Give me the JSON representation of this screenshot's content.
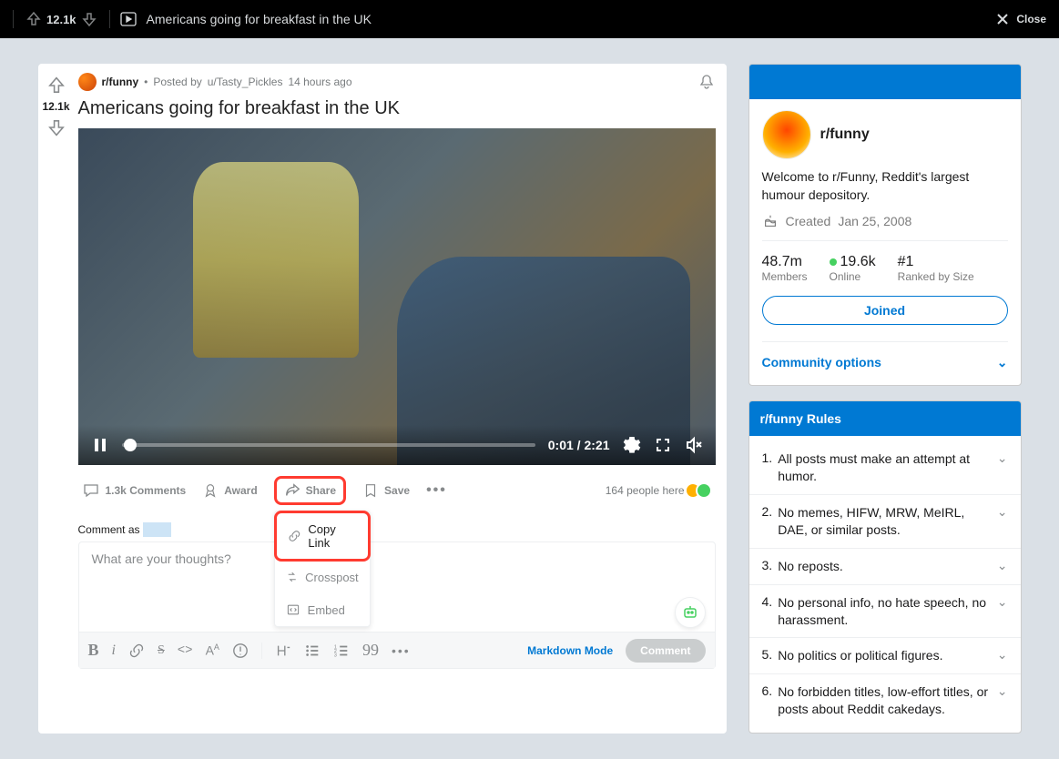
{
  "topbar": {
    "score": "12.1k",
    "title": "Americans going for breakfast in the UK",
    "close": "Close"
  },
  "post": {
    "score": "12.1k",
    "subreddit": "r/funny",
    "posted_by_prefix": "Posted by",
    "author": "u/Tasty_Pickles",
    "time": "14 hours ago",
    "title": "Americans going for breakfast in the UK"
  },
  "video": {
    "current": "0:01",
    "sep": " / ",
    "total": "2:21"
  },
  "actions": {
    "comments": "1.3k Comments",
    "award": "Award",
    "share": "Share",
    "save": "Save",
    "viewers": "164 people here"
  },
  "share_menu": {
    "copy": "Copy Link",
    "crosspost": "Crosspost",
    "embed": "Embed"
  },
  "comment": {
    "prefix": "Comment as",
    "placeholder": "What are your thoughts?",
    "markdown": "Markdown Mode",
    "submit": "Comment"
  },
  "sidebar": {
    "about_name": "r/funny",
    "about_desc": "Welcome to r/Funny, Reddit's largest humour depository.",
    "created_prefix": "Created",
    "created_date": "Jan 25, 2008",
    "members_val": "48.7m",
    "members_lab": "Members",
    "online_val": "19.6k",
    "online_lab": "Online",
    "rank_val": "#1",
    "rank_lab": "Ranked by Size",
    "join": "Joined",
    "community_opts": "Community options",
    "rules_header": "r/funny Rules",
    "rules": [
      "All posts must make an attempt at humor.",
      "No memes, HIFW, MRW, MeIRL, DAE, or similar posts.",
      "No reposts.",
      "No personal info, no hate speech, no harassment.",
      "No politics or political figures.",
      "No forbidden titles, low-effort titles, or posts about Reddit cakedays."
    ]
  }
}
